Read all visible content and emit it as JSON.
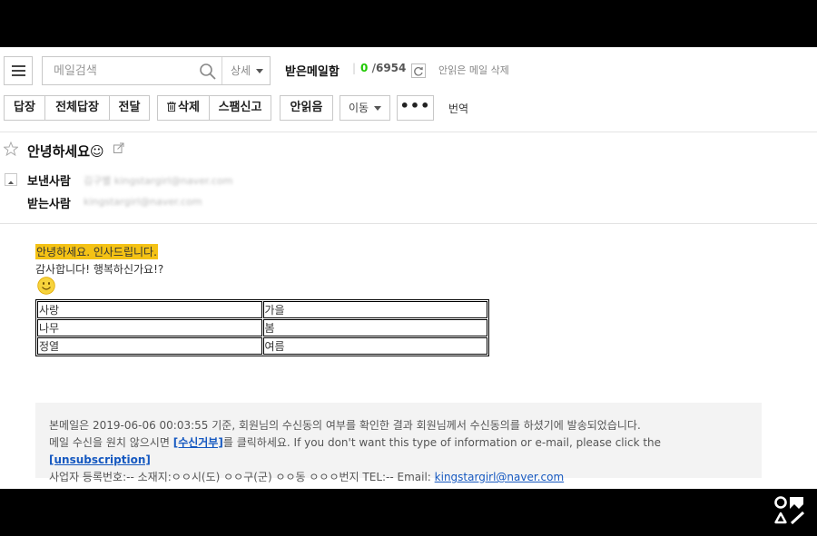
{
  "toolbar": {
    "search_placeholder": "메일검색",
    "detail_label": "상세",
    "mailbox_title": "받은메일함",
    "unread_count": "0",
    "separator": "/",
    "total_count": "6954",
    "delete_unread_label": "안읽은 메일 삭제"
  },
  "actions": {
    "reply": "답장",
    "reply_all": "전체답장",
    "forward": "전달",
    "delete": "삭제",
    "spam": "스팸신고",
    "mark_unread": "안읽음",
    "move": "이동",
    "more": "•••",
    "translate": "번역"
  },
  "mail": {
    "subject": "안녕하세요☺",
    "sender_label": "보낸사람",
    "sender_value": "김구별 kingstargirl@naver.com",
    "recipient_label": "받는사람",
    "recipient_value": "kingstargirl@naver.com",
    "body_greeting": "안녕하세요. 인사드립니다.",
    "body_thanks": "감사합니다! 행복하신가요!?",
    "table": [
      [
        "사랑",
        "가을"
      ],
      [
        "나무",
        "봄"
      ],
      [
        "정열",
        "여름"
      ]
    ]
  },
  "footer": {
    "line1": "본메일은 2019-06-06 00:03:55 기준, 회원님의 수신동의 여부를 확인한 결과 회원님께서 수신동의를 하셨기에 발송되었습니다.",
    "line2_a": "메일 수신을 원치 않으시면 ",
    "line2_link": "[수신거부]",
    "line2_b": "를 클릭하세요. If you don't want this type of information or e-mail, please click the ",
    "line2_link_en": "[unsubscription]",
    "line3_a": "사업자 등록번호:-- 소재지:ㅇㅇ시(도) ㅇㅇ구(군) ㅇㅇ동 ㅇㅇㅇ번지 TEL:-- Email: ",
    "line3_email": "kingstargirl@naver.com"
  },
  "colors": {
    "unread_count": "#1ec800",
    "highlight": "#f4c215",
    "link": "#1558c0",
    "footer_bg": "#f3f3f3"
  },
  "icons": [
    "hamburger-icon",
    "search-icon",
    "refresh-icon",
    "trash-icon",
    "star-icon",
    "popout-icon",
    "collapse-icon",
    "smiley-icon",
    "brand-logo-icon"
  ]
}
